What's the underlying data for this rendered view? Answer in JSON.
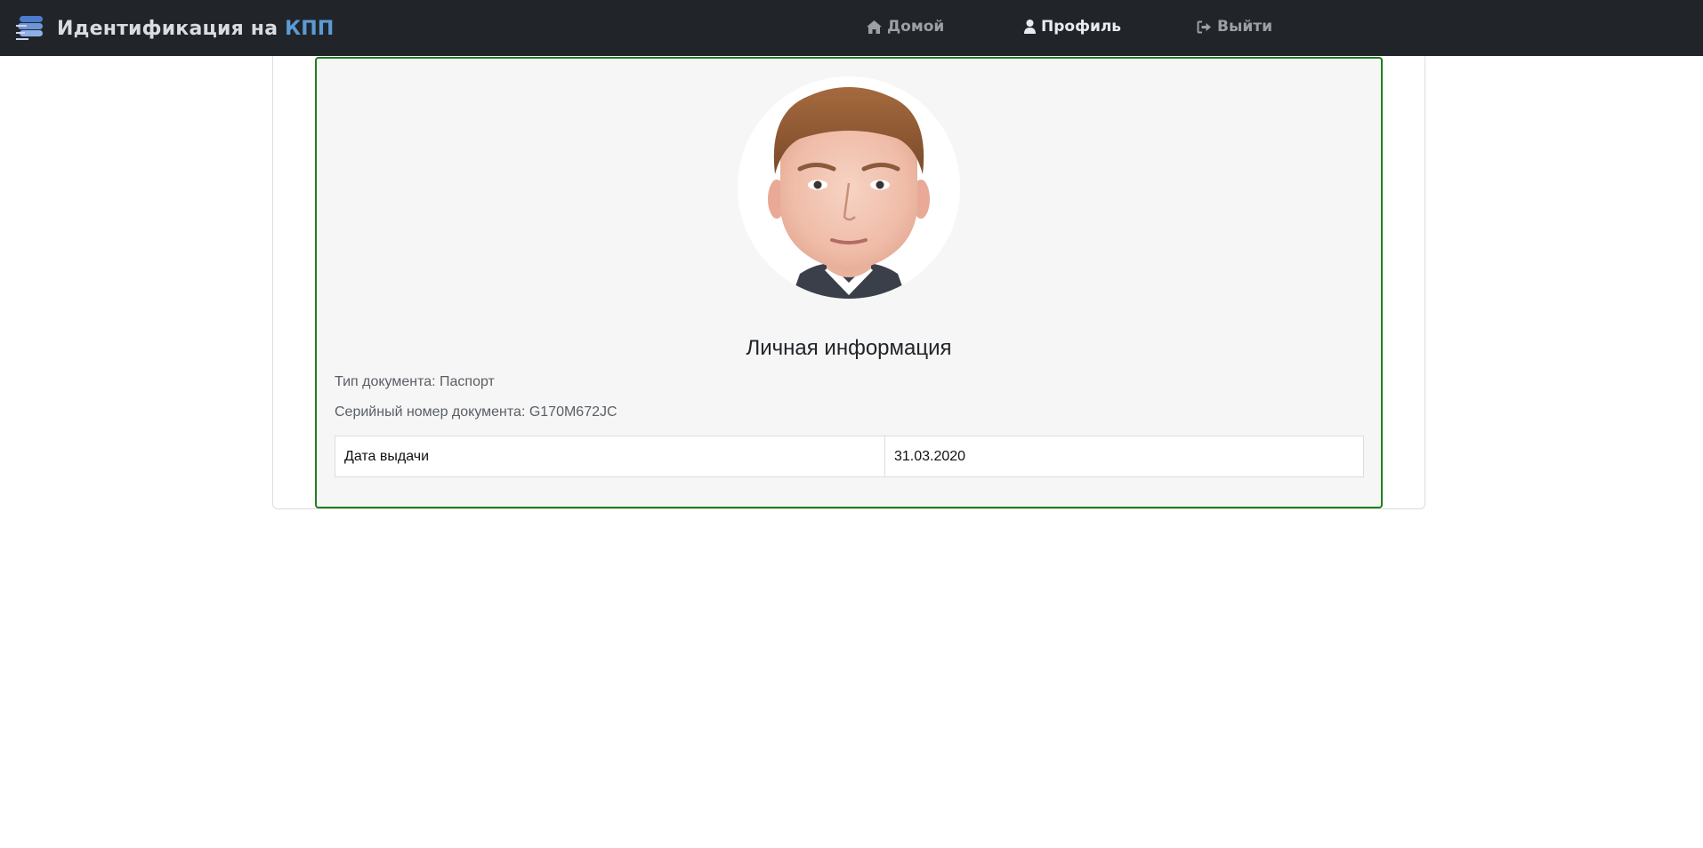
{
  "brand": {
    "name_main": "Идентификация на ",
    "name_accent": "КПП",
    "logo_icon": "stack-layers-icon"
  },
  "nav": {
    "home": {
      "label": "Домой",
      "icon": "home-icon"
    },
    "profile": {
      "label": "Профиль",
      "icon": "user-icon",
      "active": true
    },
    "logout": {
      "label": "Выйти",
      "icon": "sign-out-icon"
    }
  },
  "profile": {
    "photo": "face-photo",
    "section_title": "Личная информация",
    "document_type_label": "Тип документа: ",
    "document_type_value": "Паспорт",
    "serial_label": "Серийный номер документа: ",
    "serial_value": "G170M672JC",
    "table": [
      {
        "label": "Дата выдачи",
        "value": "31.03.2020"
      }
    ]
  },
  "colors": {
    "navbar_bg": "#212529",
    "brand_accent": "#5b9bd5",
    "card_border": "#1e7d1e",
    "card_bg": "#f6f6f6"
  }
}
